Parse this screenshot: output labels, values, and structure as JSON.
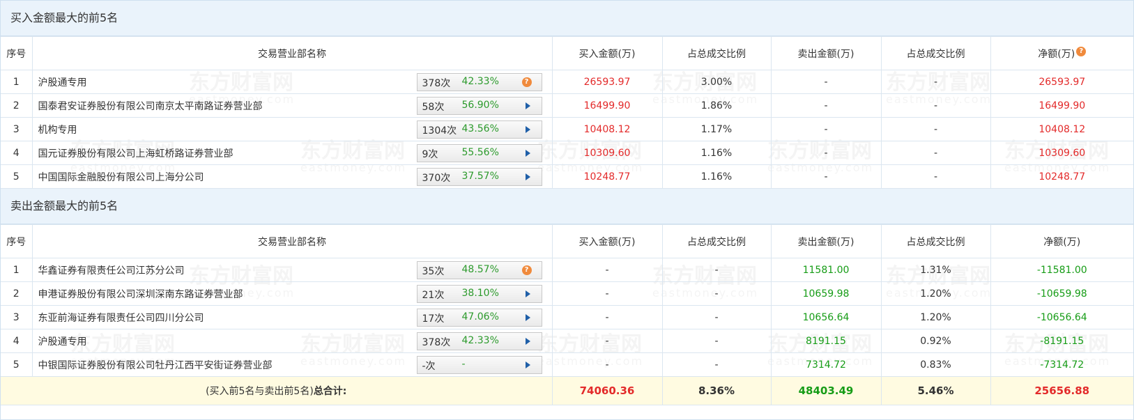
{
  "watermark": {
    "cn": "东方财富网",
    "en": "eastmoney.com"
  },
  "buy_section": {
    "title": "买入金额最大的前5名",
    "headers": [
      "序号",
      "交易营业部名称",
      "买入金额(万)",
      "占总成交比例",
      "卖出金额(万)",
      "占总成交比例",
      "净额(万)"
    ],
    "rows": [
      {
        "idx": "1",
        "name": "沪股通专用",
        "count": "378次",
        "pct": "42.33%",
        "icon": "question-icon",
        "buy": "26593.97",
        "buy_ratio": "3.00%",
        "sell": "-",
        "sell_ratio": "-",
        "net": "26593.97"
      },
      {
        "idx": "2",
        "name": "国泰君安证券股份有限公司南京太平南路证券营业部",
        "count": "58次",
        "pct": "56.90%",
        "icon": "arrow-right-icon",
        "buy": "16499.90",
        "buy_ratio": "1.86%",
        "sell": "-",
        "sell_ratio": "-",
        "net": "16499.90"
      },
      {
        "idx": "3",
        "name": "机构专用",
        "count": "1304次",
        "pct": "43.56%",
        "icon": "arrow-right-icon",
        "buy": "10408.12",
        "buy_ratio": "1.17%",
        "sell": "-",
        "sell_ratio": "-",
        "net": "10408.12"
      },
      {
        "idx": "4",
        "name": "国元证券股份有限公司上海虹桥路证券营业部",
        "count": "9次",
        "pct": "55.56%",
        "icon": "arrow-right-icon",
        "buy": "10309.60",
        "buy_ratio": "1.16%",
        "sell": "-",
        "sell_ratio": "-",
        "net": "10309.60"
      },
      {
        "idx": "5",
        "name": "中国国际金融股份有限公司上海分公司",
        "count": "370次",
        "pct": "37.57%",
        "icon": "arrow-right-icon",
        "buy": "10248.77",
        "buy_ratio": "1.16%",
        "sell": "-",
        "sell_ratio": "-",
        "net": "10248.77"
      }
    ]
  },
  "sell_section": {
    "title": "卖出金额最大的前5名",
    "headers": [
      "序号",
      "交易营业部名称",
      "买入金额(万)",
      "占总成交比例",
      "卖出金额(万)",
      "占总成交比例",
      "净额(万)"
    ],
    "rows": [
      {
        "idx": "1",
        "name": "华鑫证券有限责任公司江苏分公司",
        "count": "35次",
        "pct": "48.57%",
        "icon": "question-icon",
        "buy": "-",
        "buy_ratio": "-",
        "sell": "11581.00",
        "sell_ratio": "1.31%",
        "net": "-11581.00"
      },
      {
        "idx": "2",
        "name": "申港证券股份有限公司深圳深南东路证券营业部",
        "count": "21次",
        "pct": "38.10%",
        "icon": "arrow-right-icon",
        "buy": "-",
        "buy_ratio": "-",
        "sell": "10659.98",
        "sell_ratio": "1.20%",
        "net": "-10659.98"
      },
      {
        "idx": "3",
        "name": "东亚前海证券有限责任公司四川分公司",
        "count": "17次",
        "pct": "47.06%",
        "icon": "arrow-right-icon",
        "buy": "-",
        "buy_ratio": "-",
        "sell": "10656.64",
        "sell_ratio": "1.20%",
        "net": "-10656.64"
      },
      {
        "idx": "4",
        "name": "沪股通专用",
        "count": "378次",
        "pct": "42.33%",
        "icon": "arrow-right-icon",
        "buy": "-",
        "buy_ratio": "-",
        "sell": "8191.15",
        "sell_ratio": "0.92%",
        "net": "-8191.15"
      },
      {
        "idx": "5",
        "name": "中银国际证券股份有限公司牡丹江西平安街证券营业部",
        "count": "-次",
        "pct": "-",
        "icon": "arrow-right-icon",
        "buy": "-",
        "buy_ratio": "-",
        "sell": "7314.72",
        "sell_ratio": "0.83%",
        "net": "-7314.72"
      }
    ]
  },
  "total": {
    "label_prefix": "(买入前5名与卖出前5名)",
    "label_suffix": "总合计:",
    "buy": "74060.36",
    "buy_ratio": "8.36%",
    "sell": "48403.49",
    "sell_ratio": "5.46%",
    "net": "25656.88"
  },
  "colors": {
    "buy": "#e32a2a",
    "sell": "#169c16",
    "header_bg": "#eaf3fb",
    "total_bg": "#fffbe1"
  }
}
